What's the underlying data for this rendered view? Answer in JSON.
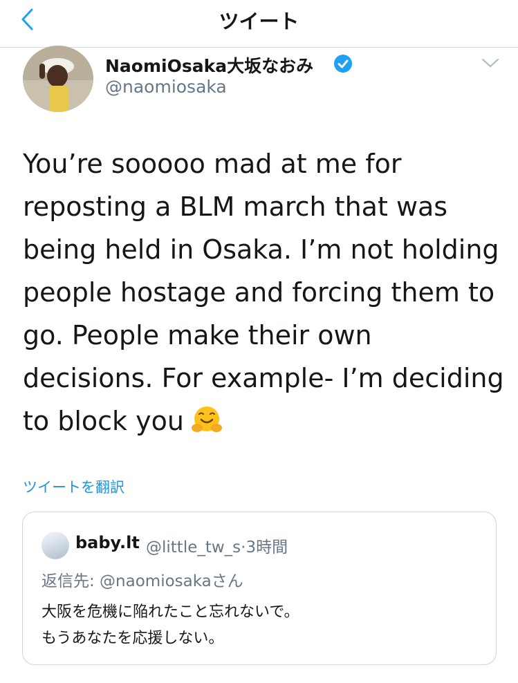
{
  "header": {
    "title": "ツイート",
    "back_icon": "chevron-left-icon"
  },
  "tweet": {
    "author": {
      "name": "NaomiOsaka大坂なおみ",
      "handle": "@naomiosaka",
      "verified": true
    },
    "text": "You’re sooooo mad at me for reposting a BLM march that was being held in Osaka. I’m not holding people hostage and forcing them to go. People make their own decisions. For example- I’m deciding to block you",
    "emoji": "hugging-face-emoji",
    "translate_label": "ツイートを翻訳"
  },
  "quoted_tweet": {
    "name": "baby.lt",
    "handle": "@little_tw_s",
    "separator": "·",
    "time": "3時間",
    "reply_to": "返信先: @naomiosakaさん",
    "lines": [
      "大阪を危機に陥れたこと忘れないで。",
      "もうあなたを応援しない。"
    ]
  },
  "colors": {
    "link": "#1b95e0",
    "secondary": "#657786",
    "border": "#ccd6dd",
    "verified": "#1da1f2"
  }
}
